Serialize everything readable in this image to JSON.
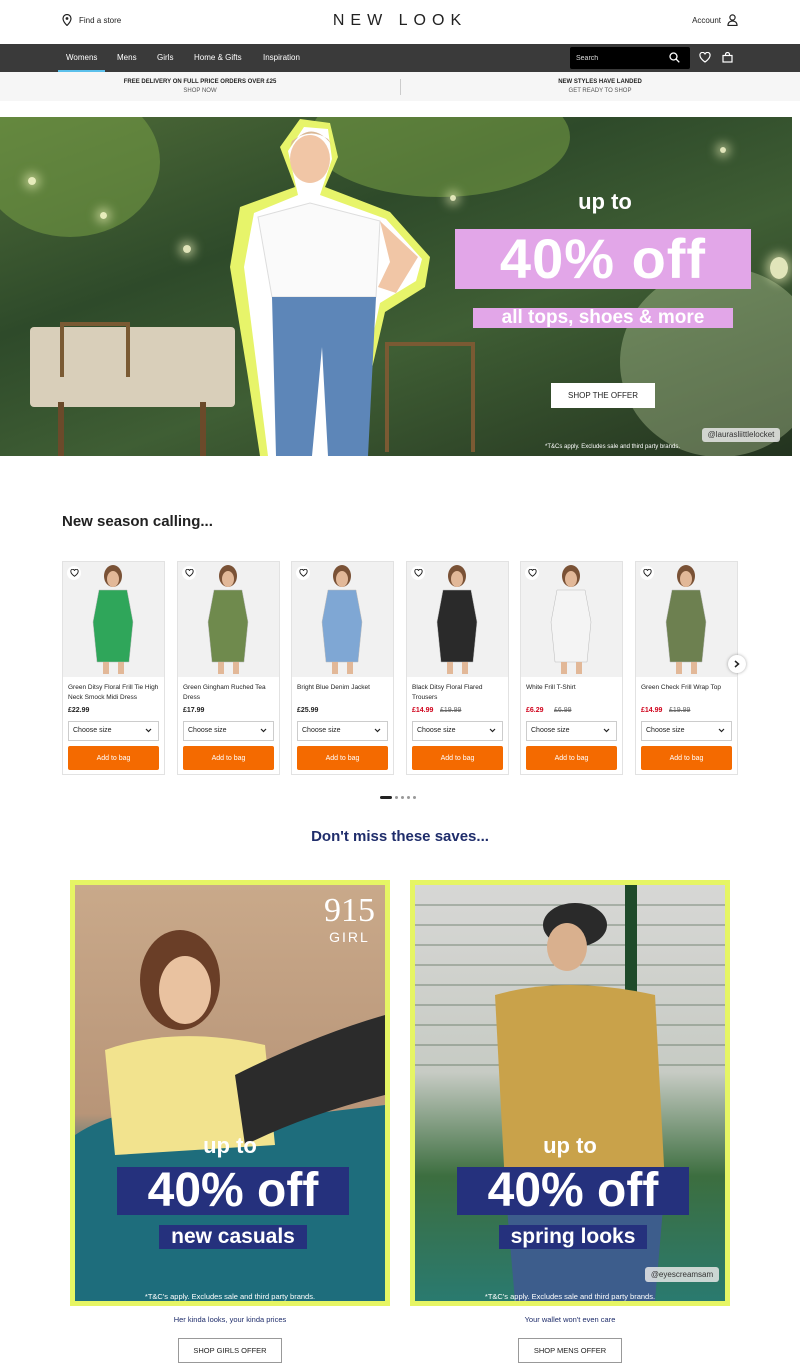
{
  "header": {
    "find_store": "Find a store",
    "logo": "NEW LOOK",
    "account": "Account"
  },
  "nav": {
    "items": [
      "Womens",
      "Mens",
      "Girls",
      "Home & Gifts",
      "Inspiration"
    ],
    "active": "Womens",
    "search_placeholder": "Search"
  },
  "promos": [
    {
      "title": "FREE DELIVERY ON FULL PRICE ORDERS OVER £25",
      "sub": "SHOP NOW"
    },
    {
      "title": "NEW STYLES HAVE LANDED",
      "sub": "GET READY TO SHOP"
    }
  ],
  "hero": {
    "up_to": "up to",
    "headline": "40% off",
    "subline": "all tops, shoes & more",
    "cta": "SHOP THE OFFER",
    "terms": "*T&Cs apply. Excludes sale and third party brands.",
    "handle": "@laurasliittlelocket",
    "accent": "#e2a6e8"
  },
  "carousel": {
    "title": "New season calling...",
    "size_label": "Choose size",
    "add_label": "Add to bag",
    "products": [
      {
        "name": "Green Ditsy Floral Frill Tie High Neck Smock Midi Dress",
        "price": "£22.99",
        "was": "",
        "color": "#2fa65a"
      },
      {
        "name": "Green Gingham Ruched Tea Dress",
        "price": "£17.99",
        "was": "",
        "color": "#6f8a4d"
      },
      {
        "name": "Bright Blue Denim Jacket",
        "price": "£25.99",
        "was": "",
        "color": "#7fa7d4"
      },
      {
        "name": "Black Ditsy Floral Flared Trousers",
        "price": "£14.99",
        "was": "£19.99",
        "color": "#2a2a2a"
      },
      {
        "name": "White Frill T-Shirt",
        "price": "£6.29",
        "was": "£6.99",
        "color": "#f4f4f4"
      },
      {
        "name": "Green Check Frill Wrap Top",
        "price": "£14.99",
        "was": "£19.99",
        "color": "#6d8050"
      }
    ],
    "pages": 5,
    "active_page": 1
  },
  "saves": {
    "title": "Don't miss these saves...",
    "tiles": [
      {
        "brand_number": "915",
        "brand_name": "GIRL",
        "up_to": "up to",
        "headline": "40% off",
        "label": "new casuals",
        "terms": "*T&C's apply. Excludes sale and third party brands.",
        "caption": "Her kinda looks, your kinda prices",
        "cta": "SHOP GIRLS OFFER",
        "handle": ""
      },
      {
        "brand_number": "",
        "brand_name": "",
        "up_to": "up to",
        "headline": "40% off",
        "label": "spring looks",
        "terms": "*T&C's apply. Excludes sale and third party brands.",
        "caption": "Your wallet won't even care",
        "cta": "SHOP MENS OFFER",
        "handle": "@eyescreamsam"
      }
    ],
    "border_color": "#e6f564",
    "label_bg": "#25317d"
  },
  "colors": {
    "nav_bg": "#3a3a3a",
    "add_to_bag": "#f46a00",
    "sale_price": "#d0021b"
  }
}
